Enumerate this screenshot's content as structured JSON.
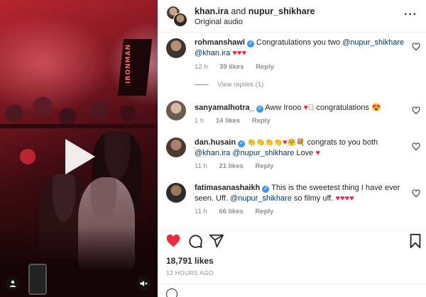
{
  "header": {
    "user1": "khan.ira",
    "and": "and",
    "user2": "nupur_shikhare",
    "audio": "Original audio",
    "more": "···"
  },
  "comments": [
    {
      "user": "rohmanshawl",
      "verified": true,
      "text_parts": [
        "Congratulations you two ",
        "@nupur_shikhare",
        " ",
        "@khan.ira",
        " "
      ],
      "emoji": "♥♥♥",
      "time": "12 h",
      "likes": "39 likes",
      "reply": "Reply",
      "avatar_color": "#3d3530"
    },
    {
      "user": "sanyamalhotra_",
      "verified": true,
      "text_parts": [
        "Aww Irooo ",
        "♥⃞",
        " congratulations "
      ],
      "emoji": "😍",
      "time": "1 h",
      "likes": "14 likes",
      "reply": "Reply",
      "avatar_color": "#6b5a4e"
    },
    {
      "user": "dan.husain",
      "verified": true,
      "text_parts": [
        "👏👏👏👏",
        "♥",
        "🤗",
        "💐",
        " congrats to you both ",
        "@khan.ira",
        " ",
        "@nupur_shikhare",
        " Love "
      ],
      "emoji": "♥",
      "time": "11 h",
      "likes": "21 likes",
      "reply": "Reply",
      "avatar_color": "#4a3a32"
    },
    {
      "user": "fatimasanashaikh",
      "verified": true,
      "text_parts": [
        "This is the sweetest thing I have ever seen. Uff. ",
        "@nupur_shikhare",
        " so filmy uff. "
      ],
      "emoji": "♥♥♥♥",
      "time": "11 h",
      "likes": "66 likes",
      "reply": "Reply",
      "avatar_color": "#2e2a28"
    }
  ],
  "view_replies": "View replies (1)",
  "post": {
    "likes": "18,791 likes",
    "posted": "12 HOURS AGO"
  },
  "video": {
    "banner_text": "IRONMAN"
  },
  "colors": {
    "link": "#00376b",
    "heart": "#ed2a3d",
    "verified": "#3897f0",
    "muted": "#8e8e8e"
  },
  "icons": [
    "more-icon",
    "heart-icon",
    "comment-icon",
    "share-icon",
    "save-icon",
    "play-icon",
    "user-tag-icon",
    "mute-icon",
    "smile-icon"
  ]
}
